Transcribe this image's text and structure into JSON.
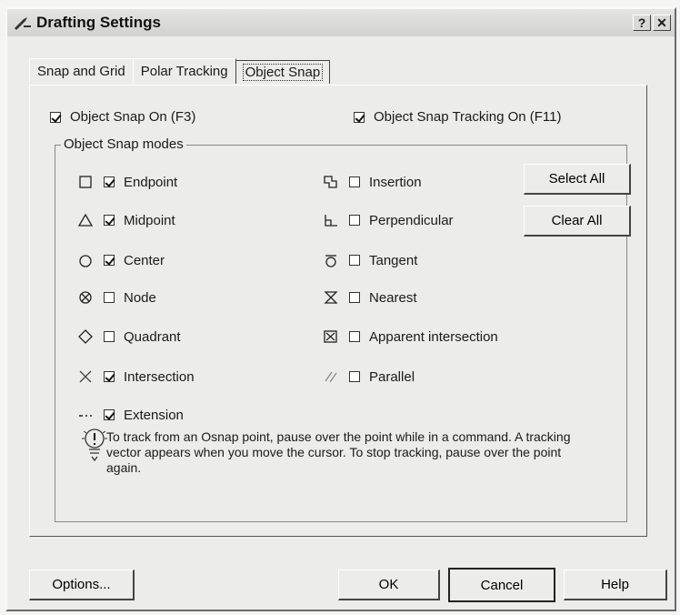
{
  "window": {
    "title": "Drafting Settings",
    "help_btn": "?",
    "close_btn": "✕"
  },
  "tabs": [
    {
      "label": "Snap and Grid"
    },
    {
      "label": "Polar Tracking"
    },
    {
      "label": "Object Snap"
    }
  ],
  "options": {
    "snap_on": {
      "label": "Object Snap On (F3)",
      "checked": true
    },
    "tracking_on": {
      "label": "Object Snap Tracking On (F11)",
      "checked": true
    }
  },
  "group": {
    "label": "Object Snap modes"
  },
  "modes_left": [
    {
      "label": "Endpoint",
      "checked": true,
      "icon": "endpoint-icon"
    },
    {
      "label": "Midpoint",
      "checked": true,
      "icon": "midpoint-icon"
    },
    {
      "label": "Center",
      "checked": true,
      "icon": "center-icon"
    },
    {
      "label": "Node",
      "checked": false,
      "icon": "node-icon"
    },
    {
      "label": "Quadrant",
      "checked": false,
      "icon": "quadrant-icon"
    },
    {
      "label": "Intersection",
      "checked": true,
      "icon": "intersection-icon"
    },
    {
      "label": "Extension",
      "checked": true,
      "icon": "extension-icon"
    }
  ],
  "modes_right": [
    {
      "label": "Insertion",
      "checked": false,
      "icon": "insertion-icon"
    },
    {
      "label": "Perpendicular",
      "checked": false,
      "icon": "perpendicular-icon"
    },
    {
      "label": "Tangent",
      "checked": false,
      "icon": "tangent-icon"
    },
    {
      "label": "Nearest",
      "checked": false,
      "icon": "nearest-icon"
    },
    {
      "label": "Apparent intersection",
      "checked": false,
      "icon": "apparent-intersection-icon"
    },
    {
      "label": "Parallel",
      "checked": false,
      "icon": "parallel-icon"
    }
  ],
  "buttons": {
    "select_all": "Select All",
    "clear_all": "Clear All",
    "options": "Options...",
    "ok": "OK",
    "cancel": "Cancel",
    "help": "Help"
  },
  "hint": {
    "text": "To track from an Osnap point, pause over the point while in a command.  A tracking vector appears when you move the cursor. To stop tracking, pause over the point again."
  }
}
